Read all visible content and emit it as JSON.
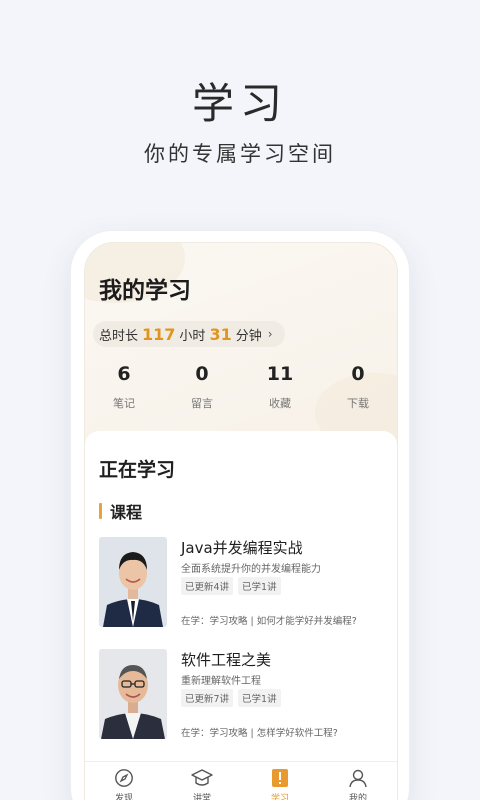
{
  "hero": {
    "title": "学习",
    "subtitle": "你的专属学习空间"
  },
  "my_learning": {
    "title": "我的学习",
    "duration": {
      "prefix": "总时长",
      "hours": "117",
      "hours_unit": "小时",
      "minutes": "31",
      "minutes_unit": "分钟",
      "arrow": "›"
    },
    "stats": [
      {
        "value": "6",
        "label": "笔记"
      },
      {
        "value": "0",
        "label": "留言"
      },
      {
        "value": "11",
        "label": "收藏"
      },
      {
        "value": "0",
        "label": "下载"
      }
    ]
  },
  "studying": {
    "title": "正在学习",
    "category": "课程",
    "courses": [
      {
        "title": "Java并发编程实战",
        "desc": "全面系统提升你的并发编程能力",
        "tags": [
          "已更新4讲",
          "已学1讲"
        ],
        "current": "在学：学习攻略 | 如何才能学好并发编程?"
      },
      {
        "title": "软件工程之美",
        "desc": "重新理解软件工程",
        "tags": [
          "已更新7讲",
          "已学1讲"
        ],
        "current": "在学：学习攻略 | 怎样学好软件工程?"
      }
    ]
  },
  "tabbar": {
    "active_color": "#e89a2f",
    "items": [
      {
        "label": "发现",
        "icon": "compass-icon"
      },
      {
        "label": "讲堂",
        "icon": "graduation-cap-icon"
      },
      {
        "label": "学习",
        "icon": "book-icon"
      },
      {
        "label": "我的",
        "icon": "user-icon"
      }
    ]
  }
}
